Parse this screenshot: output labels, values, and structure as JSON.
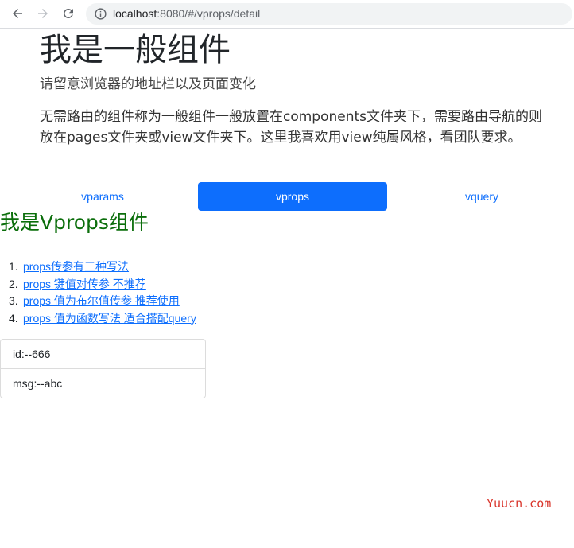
{
  "browser": {
    "url_host": "localhost",
    "url_path": ":8080/#/vprops/detail"
  },
  "jumbotron": {
    "title": "我是一般组件",
    "subtitle": "请留意浏览器的地址栏以及页面变化",
    "description": "无需路由的组件称为一般组件一般放置在components文件夹下，需要路由导航的则放在pages文件夹或view文件夹下。这里我喜欢用view纯属风格，看团队要求。"
  },
  "tabs": [
    {
      "label": "vparams",
      "active": false
    },
    {
      "label": "vprops",
      "active": true
    },
    {
      "label": "vquery",
      "active": false
    }
  ],
  "component_heading": "我是Vprops组件",
  "links": [
    {
      "num": "1.",
      "label": "props传参有三种写法"
    },
    {
      "num": "2.",
      "label": "props 键值对传参 不推荐"
    },
    {
      "num": "3.",
      "label": "props 值为布尔值传参 推荐使用"
    },
    {
      "num": "4.",
      "label": "props 值为函数写法 适合搭配query"
    }
  ],
  "details": [
    "id:--666",
    "msg:--abc"
  ],
  "watermark": "Yuucn.com",
  "colors": {
    "accent": "#0d6efd",
    "heading_green": "#0b6e0b",
    "watermark_red": "#d9352b"
  }
}
